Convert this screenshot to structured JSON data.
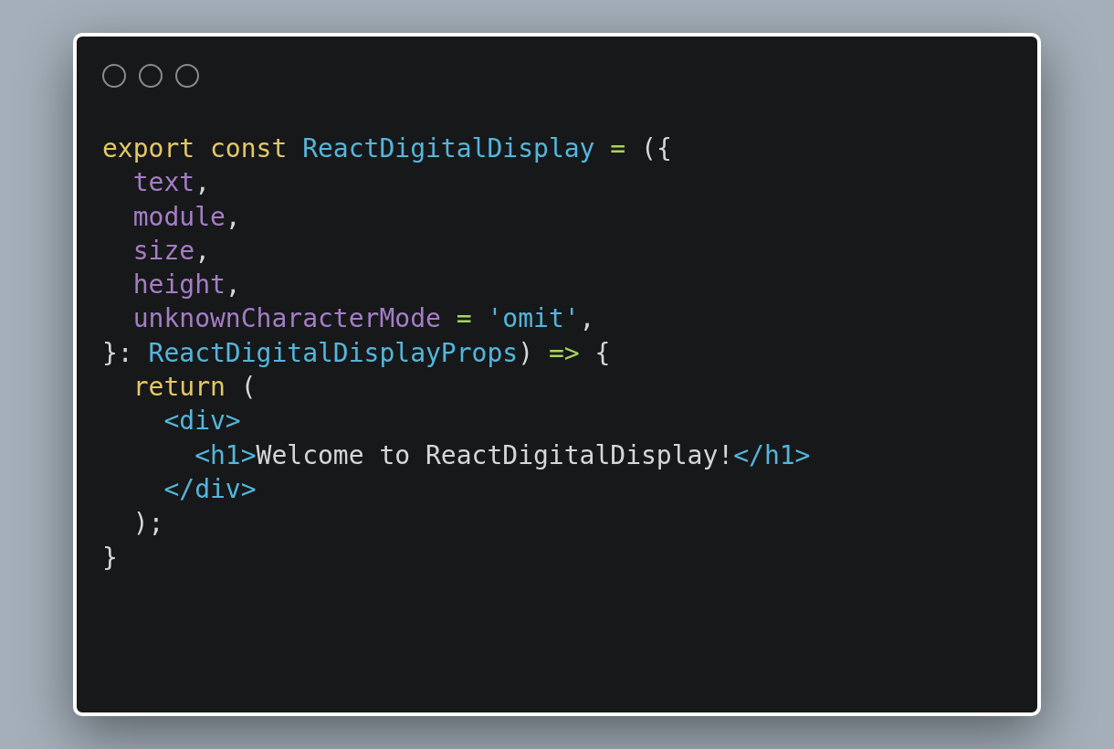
{
  "window": {
    "controls": [
      {
        "kind": "dot"
      },
      {
        "kind": "dot"
      },
      {
        "kind": "dot"
      }
    ]
  },
  "code": {
    "lines": [
      {
        "tokens": [
          {
            "kind": "keyword",
            "text": "export const "
          },
          {
            "kind": "name",
            "text": "ReactDigitalDisplay"
          },
          {
            "kind": "operator",
            "text": " = "
          },
          {
            "kind": "plain",
            "text": "({"
          }
        ]
      },
      {
        "tokens": [
          {
            "kind": "param",
            "text": "  text"
          },
          {
            "kind": "plain",
            "text": ","
          }
        ]
      },
      {
        "tokens": [
          {
            "kind": "param",
            "text": "  module"
          },
          {
            "kind": "plain",
            "text": ","
          }
        ]
      },
      {
        "tokens": [
          {
            "kind": "param",
            "text": "  size"
          },
          {
            "kind": "plain",
            "text": ","
          }
        ]
      },
      {
        "tokens": [
          {
            "kind": "param",
            "text": "  height"
          },
          {
            "kind": "plain",
            "text": ","
          }
        ]
      },
      {
        "tokens": [
          {
            "kind": "param",
            "text": "  unknownCharacterMode"
          },
          {
            "kind": "operator",
            "text": " = "
          },
          {
            "kind": "name",
            "text": "'omit'"
          },
          {
            "kind": "plain",
            "text": ","
          }
        ]
      },
      {
        "tokens": [
          {
            "kind": "plain",
            "text": "}: "
          },
          {
            "kind": "name",
            "text": "ReactDigitalDisplayProps"
          },
          {
            "kind": "plain",
            "text": ") "
          },
          {
            "kind": "operator",
            "text": "=>"
          },
          {
            "kind": "plain",
            "text": " {"
          }
        ]
      },
      {
        "tokens": [
          {
            "kind": "keyword",
            "text": "  return"
          },
          {
            "kind": "plain",
            "text": " ("
          }
        ]
      },
      {
        "tokens": [
          {
            "kind": "name",
            "text": "    <div>"
          }
        ]
      },
      {
        "tokens": [
          {
            "kind": "name",
            "text": "      <h1>"
          },
          {
            "kind": "plain",
            "text": "Welcome to ReactDigitalDisplay!"
          },
          {
            "kind": "name",
            "text": "</h1>"
          }
        ]
      },
      {
        "tokens": [
          {
            "kind": "name",
            "text": "    </div>"
          }
        ]
      },
      {
        "tokens": [
          {
            "kind": "plain",
            "text": "  );"
          }
        ]
      },
      {
        "tokens": [
          {
            "kind": "plain",
            "text": "}"
          }
        ]
      }
    ]
  }
}
